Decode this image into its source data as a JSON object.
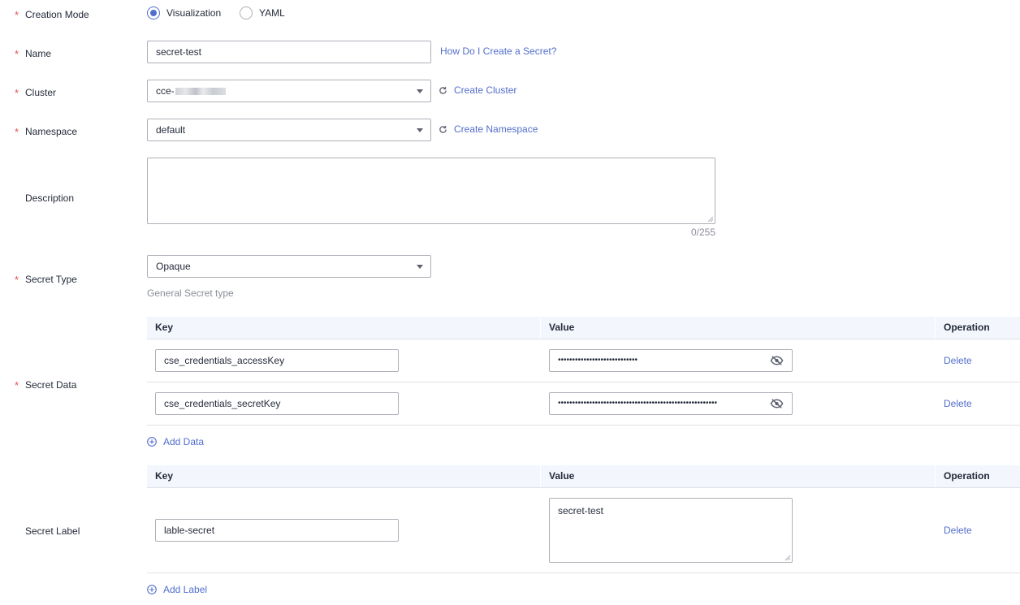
{
  "form": {
    "creation_mode": {
      "label": "Creation Mode",
      "options": [
        {
          "label": "Visualization",
          "selected": true
        },
        {
          "label": "YAML",
          "selected": false
        }
      ]
    },
    "name": {
      "label": "Name",
      "value": "secret-test",
      "help_link": "How Do I Create a Secret?"
    },
    "cluster": {
      "label": "Cluster",
      "value_prefix": "cce-",
      "create_link": "Create Cluster"
    },
    "namespace": {
      "label": "Namespace",
      "value": "default",
      "create_link": "Create Namespace"
    },
    "description": {
      "label": "Description",
      "value": "",
      "counter": "0/255"
    },
    "secret_type": {
      "label": "Secret Type",
      "value": "Opaque",
      "hint": "General Secret type"
    },
    "secret_data": {
      "label": "Secret Data",
      "columns": [
        "Key",
        "Value",
        "Operation"
      ],
      "rows": [
        {
          "key": "cse_credentials_accessKey",
          "value": "••••••••••••••••••••••••••••",
          "operation": "Delete"
        },
        {
          "key": "cse_credentials_secretKey",
          "value": "••••••••••••••••••••••••••••••••••••••••••••••••••••••••",
          "operation": "Delete"
        }
      ],
      "add_label": "Add Data"
    },
    "secret_label": {
      "label": "Secret Label",
      "columns": [
        "Key",
        "Value",
        "Operation"
      ],
      "rows": [
        {
          "key": "lable-secret",
          "value": "secret-test",
          "operation": "Delete"
        }
      ],
      "add_label": "Add Label"
    }
  },
  "colors": {
    "accent": "#526ecc",
    "required": "#e5504f",
    "border": "#adb0b8",
    "table_header": "#f3f6fc"
  },
  "icons": {
    "refresh": "refresh-icon",
    "eye_hidden": "eye-slash-icon",
    "add": "plus-circle-icon",
    "caret": "chevron-down-icon"
  }
}
